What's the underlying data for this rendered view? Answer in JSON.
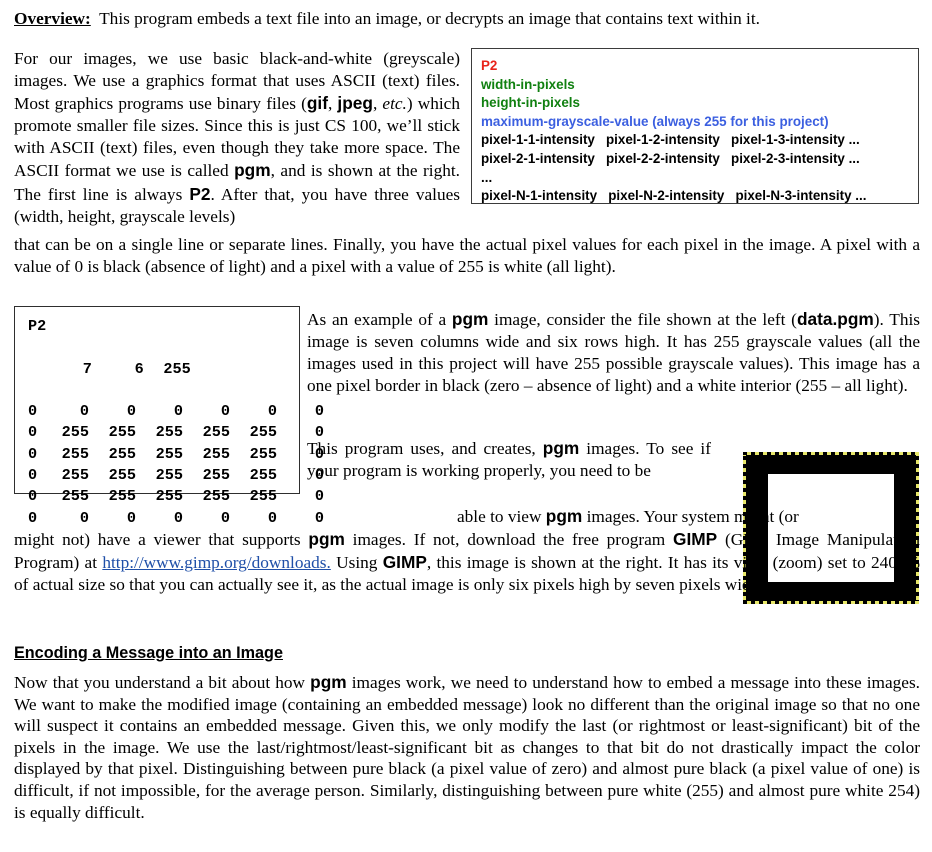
{
  "document": {
    "overview": {
      "label": "Overview:",
      "text": "This program embeds a text file into an image, or decrypts an image that contains text within it."
    },
    "intro_paragraph": {
      "seg1": "For our images, we use basic black-and-white (greyscale) images.  We use a graphics format that uses ASCII (text) files.  Most graphics programs use binary files (",
      "gif": "gif",
      "comma1": ", ",
      "jpeg": "jpeg",
      "comma2": ", ",
      "etc": "etc.",
      "seg2": ") which promote smaller file sizes.  Since this is just CS 100, we’ll stick with ASCII (text) files, even though they take more space. The ASCII format we use is called ",
      "pgm": "pgm",
      "seg3": ", and is shown at the right.  The first line is always ",
      "p2": "P2",
      "seg4": ". After that, you have three values (width, height, grayscale levels)"
    },
    "continuation_paragraph": {
      "text": "that can be on a single line or separate lines.  Finally, you have the actual pixel values for each pixel in the image.  A pixel with a value of 0 is black (absence of light) and a pixel with a value of 255 is white (all light)."
    },
    "format_box": {
      "lines": [
        {
          "text": "P2",
          "color": "#e8231a"
        },
        {
          "text": "width-in-pixels",
          "color": "#108010"
        },
        {
          "text": "height-in-pixels",
          "color": "#108010"
        },
        {
          "text": "maximum-grayscale-value (always 255 for this project)",
          "color": "#3b5fe0"
        },
        {
          "text": "pixel-1-1-intensity   pixel-1-2-intensity   pixel-1-3-intensity ...",
          "color": "#000000"
        },
        {
          "text": "pixel-2-1-intensity   pixel-2-2-intensity   pixel-2-3-intensity ...",
          "color": "#000000"
        },
        {
          "text": "...",
          "color": "#000000"
        },
        {
          "text": "pixel-N-1-intensity   pixel-N-2-intensity   pixel-N-3-intensity ...",
          "color": "#000000"
        }
      ]
    },
    "data_box": {
      "magic": "P2",
      "header_row": [
        "7",
        "6",
        "255"
      ],
      "pixel_rows": [
        [
          "0",
          "0",
          "0",
          "0",
          "0",
          "0",
          "0"
        ],
        [
          "0",
          "255",
          "255",
          "255",
          "255",
          "255",
          "0"
        ],
        [
          "0",
          "255",
          "255",
          "255",
          "255",
          "255",
          "0"
        ],
        [
          "0",
          "255",
          "255",
          "255",
          "255",
          "255",
          "0"
        ],
        [
          "0",
          "255",
          "255",
          "255",
          "255",
          "255",
          "0"
        ],
        [
          "0",
          "0",
          "0",
          "0",
          "0",
          "0",
          "0"
        ]
      ]
    },
    "example_paragraph": {
      "seg1": "As an example of a ",
      "pgm": "pgm",
      "seg2": " image, consider the file shown at the left (",
      "filename": "data.pgm",
      "seg3": ").  This image is seven columns wide and six rows high.  It has 255 grayscale values (all the images used in this project will have 255 possible grayscale values).  This image has a one pixel border in black (zero – absence of light) and a white interior (255 – all light)."
    },
    "program_paragraph": {
      "seg1": "This program uses, and creates, ",
      "pgm": "pgm",
      "seg2": " images.  To see if your program is working properly, you need to be"
    },
    "gimp_paragraph": {
      "line1_seg1": "able to view ",
      "line1_pgm": "pgm",
      "line1_seg2": " images.  Your system might (or",
      "rest_seg1": "might not) have a viewer that supports ",
      "rest_pgm": "pgm",
      "rest_seg2": " images.  If not, download the free program ",
      "gimp1": "GIMP",
      "rest_seg3": " (GNU Image Manipulation Program) at ",
      "url": "http://www.gimp.org/downloads.",
      "rest_seg4": " Using ",
      "gimp2": "GIMP",
      "rest_seg5": ", this image is shown at the right.  It has its view (zoom) set to 2400% of actual size so that you can actually see it, as the actual image is only six pixels high by seven pixels wide."
    },
    "encoding_section": {
      "heading": "Encoding a Message into an Image",
      "para_seg1": "Now that you understand a bit about how ",
      "para_pgm": "pgm",
      "para_seg2": " images work, we need to understand how to embed a message into these images.  We want to make the modified image (containing an embedded message) look no different than the original image so that no one will suspect it contains an embedded message.  Given this, we only modify the last (or rightmost or least-significant) bit of the pixels in the image.  We use the last/rightmost/least-significant bit as changes to that bit do not drastically impact the color displayed by that pixel.  Distinguishing between pure black (a pixel value of zero) and almost pure black (a pixel value of one) is difficult, if not impossible, for the average person.  Similarly, distinguishing between pure white (255) and almost pure white 254) is equally difficult."
    },
    "gimp_image": {
      "alt": "pgm image rendered in GIMP: black border with white interior",
      "border_color": "#000000",
      "interior_color": "#ffffff",
      "selection_color": "#e7e76a"
    }
  }
}
